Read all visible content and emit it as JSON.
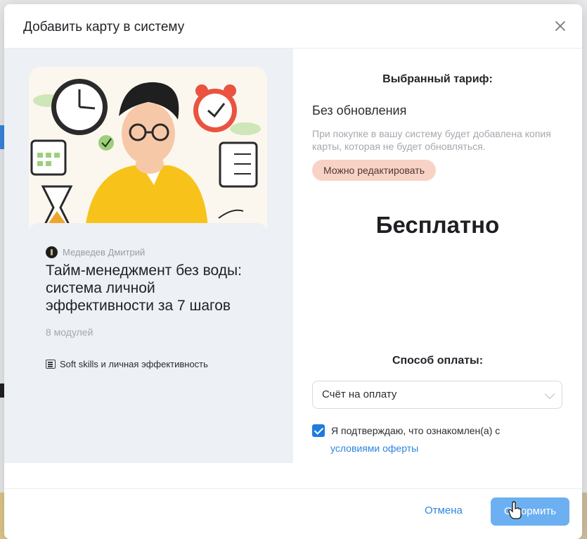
{
  "modal": {
    "title": "Добавить карту в систему",
    "close_icon": "close-icon"
  },
  "course": {
    "author": "Медведев Дмитрий",
    "title": "Тайм-менеджмент без воды: система личной эффективности за 7 шагов",
    "modules": "8 модулей",
    "category": "Soft skills и личная эффективность",
    "category_icon": "list-icon"
  },
  "tariff": {
    "heading": "Выбранный тариф:",
    "name": "Без обновления",
    "description": "При покупке в вашу систему будет добавлена копия карты, которая не будет обновляться.",
    "badge": "Можно редактировать",
    "price": "Бесплатно"
  },
  "payment": {
    "heading": "Способ оплаты:",
    "selected": "Счёт на оплату",
    "consent_text": "Я подтверждаю, что ознакомлен(а) с",
    "consent_link": "условиями оферты",
    "consent_checked": true
  },
  "footer": {
    "cancel_label": "Отмена",
    "submit_label": "Оформить"
  },
  "colors": {
    "accent": "#1f7bde",
    "link": "#2f86de",
    "submit_bg": "#6cb0f1",
    "badge_bg": "#f9d2c6",
    "left_panel_bg": "#edf0f4"
  }
}
